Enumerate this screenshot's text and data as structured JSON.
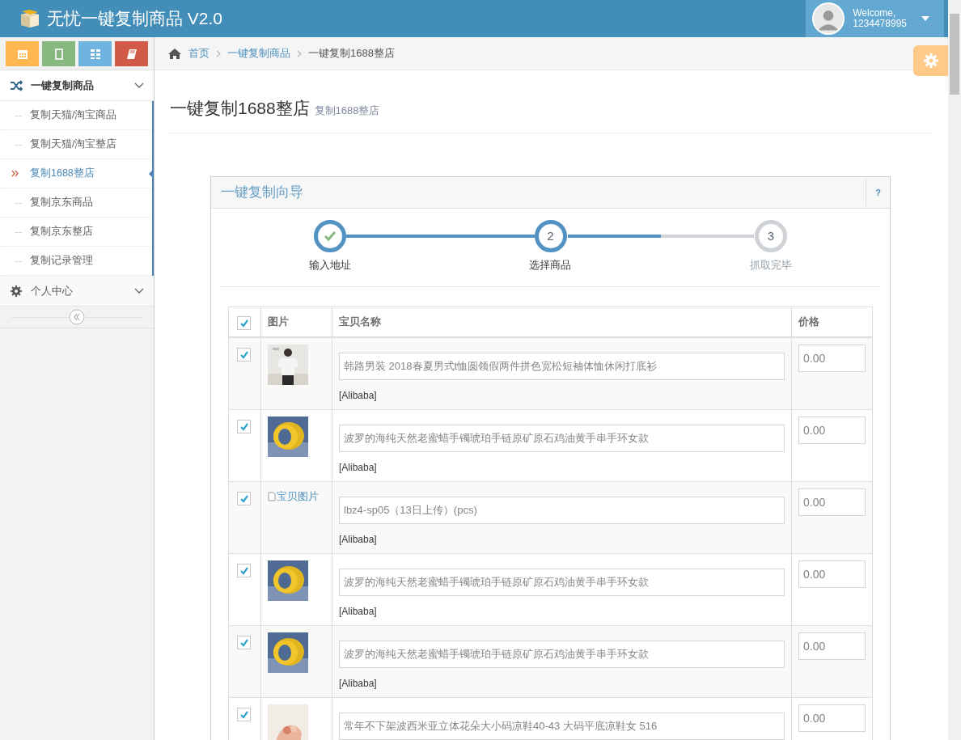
{
  "app": {
    "title": "无忧一键复制商品 V2.0"
  },
  "user": {
    "greeting": "Welcome,",
    "name": "1234478995"
  },
  "shortcuts": [
    {
      "kind": "calendar",
      "color": "#ffb752"
    },
    {
      "kind": "tablet",
      "color": "#87b87f"
    },
    {
      "kind": "grid",
      "color": "#6fb3e0"
    },
    {
      "kind": "book",
      "color": "#d15b47"
    }
  ],
  "sidebar": {
    "items": [
      {
        "label": "一键复制商品",
        "kind": "shuffle",
        "expanded": true,
        "children": [
          {
            "label": "复制天猫/淘宝商品",
            "selected": false
          },
          {
            "label": "复制天猫/淘宝整店",
            "selected": false
          },
          {
            "label": "复制1688整店",
            "selected": true
          },
          {
            "label": "复制京东商品",
            "selected": false
          },
          {
            "label": "复制京东整店",
            "selected": false
          },
          {
            "label": "复制记录管理",
            "selected": false
          }
        ]
      },
      {
        "label": "个人中心",
        "kind": "gear",
        "expanded": false
      }
    ]
  },
  "breadcrumbs": [
    {
      "label": "首页",
      "link": true
    },
    {
      "label": "一键复制商品",
      "link": true
    },
    {
      "label": "一键复制1688整店",
      "link": false
    }
  ],
  "page": {
    "title": "一键复制1688整店",
    "subtitle": "复制1688整店"
  },
  "wizard": {
    "title": "一键复制向导",
    "help": "?",
    "steps": [
      {
        "label": "输入地址",
        "complete": true,
        "reached": true
      },
      {
        "label": "选择商品",
        "number": "2",
        "complete": false,
        "reached": true
      },
      {
        "label": "抓取完毕",
        "number": "3",
        "complete": false,
        "reached": false
      }
    ],
    "level": 0.5
  },
  "table": {
    "all_checked": true,
    "columns": [
      "图片",
      "宝贝名称",
      "价格"
    ],
    "rows": [
      {
        "checked": true,
        "kind": "picture",
        "name": "韩路男装 2018春夏男式t恤圆领假两件拼色宽松短袖体恤休闲打底衫",
        "source": "[Alibaba]",
        "price": "0.00"
      },
      {
        "checked": true,
        "kind": "picture",
        "name": "波罗的海纯天然老蜜蜡手镯琥珀手链原矿原石鸡油黄手串手环女款",
        "source": "[Alibaba]",
        "price": "0.00"
      },
      {
        "checked": true,
        "kind": "broken",
        "image_alt": "宝贝图片",
        "name": "lbz4-sp05（13日上传）(pcs)",
        "source": "[Alibaba]",
        "price": "0.00"
      },
      {
        "checked": true,
        "kind": "picture",
        "name": "波罗的海纯天然老蜜蜡手镯琥珀手链原矿原石鸡油黄手串手环女款",
        "source": "[Alibaba]",
        "price": "0.00"
      },
      {
        "checked": true,
        "kind": "picture",
        "name": "波罗的海纯天然老蜜蜡手镯琥珀手链原矿原石鸡油黄手串手环女款",
        "source": "[Alibaba]",
        "price": "0.00"
      },
      {
        "checked": true,
        "kind": "picture",
        "name": "常年不下架波西米亚立体花朵大小码凉鞋40-43 大码平底凉鞋女 516",
        "price": "0.00"
      }
    ]
  }
}
